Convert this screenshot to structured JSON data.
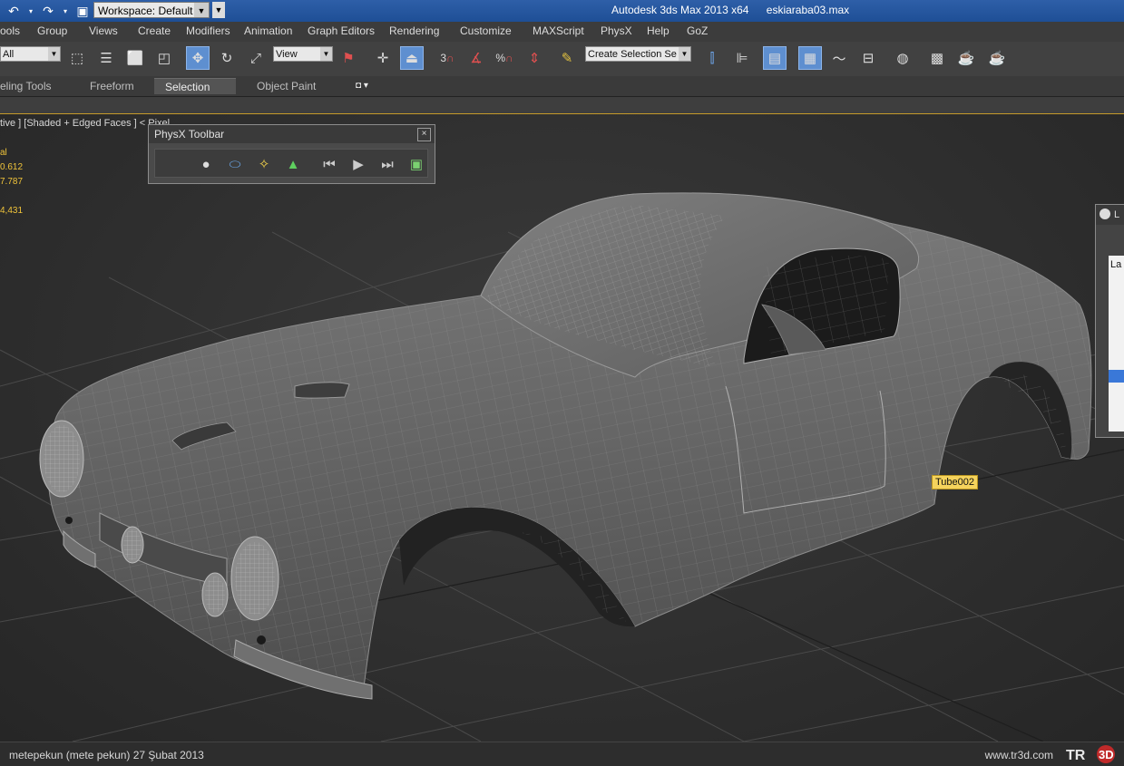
{
  "titlebar": {
    "workspace": "Workspace: Default",
    "app_name": "Autodesk 3ds Max  2013 x64",
    "filename": "eskiaraba03.max"
  },
  "menu": [
    "ools",
    "Group",
    "Views",
    "Create",
    "Modifiers",
    "Animation",
    "Graph Editors",
    "Rendering",
    "Customize",
    "MAXScript",
    "PhysX",
    "Help",
    "GoZ"
  ],
  "toolbar": {
    "filter_value": "All",
    "coord_value": "View",
    "selection_set_placeholder": "Create Selection Se",
    "snap_angle_label": "3",
    "percent_snap_label": "%"
  },
  "ribbon": {
    "tabs": [
      "eling Tools",
      "Freeform",
      "Selection",
      "Object Paint"
    ],
    "active_tab": "Selection"
  },
  "viewport": {
    "label": "tive ] [Shaded + Edged Faces ]  < Pixel",
    "stats": {
      "header": "al",
      "line1": "0.612",
      "line2": "7.787",
      "line3": "4,431"
    },
    "object_tag": "Tube002",
    "colors": {
      "background": "#2f2f2f",
      "grid": "#4a4a4a",
      "car_body": "#6e6e6e",
      "stat_text": "#f0c43a",
      "active_tool": "#5e8fd0"
    }
  },
  "physx_toolbar": {
    "title": "PhysX Toolbar",
    "close": "×",
    "icons": [
      "sphere-icon",
      "capsule-icon",
      "spark-icon",
      "cloth-icon",
      "reset-sim-icon",
      "play-sim-icon",
      "step-sim-icon",
      "explorer-icon"
    ]
  },
  "layer_panel": {
    "header": "L",
    "column": "La"
  },
  "status": {
    "credit": "metepekun (mete pekun)  27 Şubat 2013",
    "site": "www.tr3d.com",
    "logo": "TR3D"
  }
}
